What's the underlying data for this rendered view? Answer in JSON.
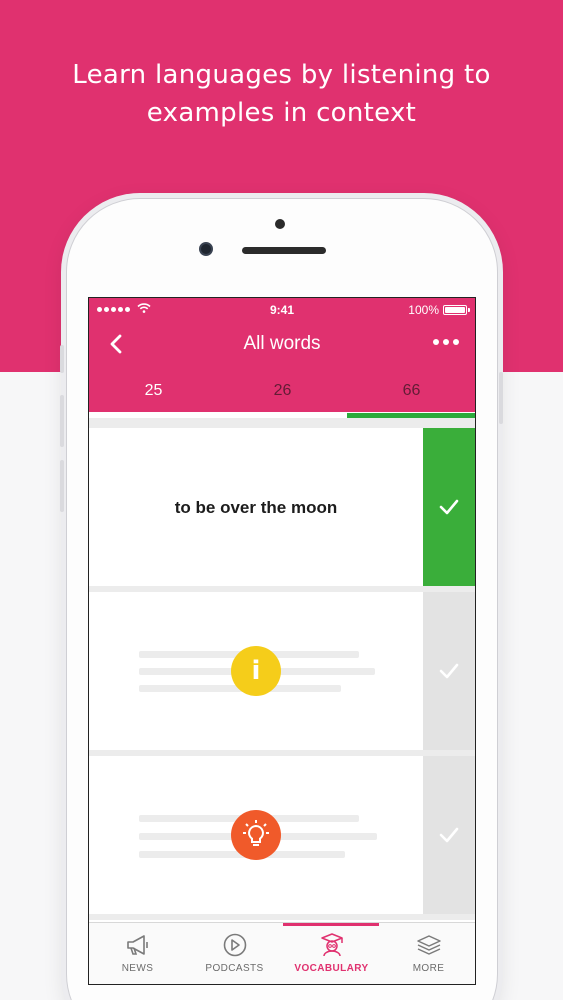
{
  "promo": {
    "headline_line1": "Learn languages by listening to",
    "headline_line2": "examples in context",
    "background_color": "#e0316f"
  },
  "status_bar": {
    "time": "9:41",
    "battery": "100%"
  },
  "nav": {
    "title": "All words",
    "back_icon": "chevron-left-icon",
    "more_icon": "more-dots-icon"
  },
  "count_tabs": [
    {
      "label": "25",
      "active": false
    },
    {
      "label": "26",
      "active": false
    },
    {
      "label": "66",
      "active": true
    }
  ],
  "cards": [
    {
      "text": "to be over the moon",
      "checked": true
    },
    {
      "icon": "info-icon",
      "checked": false
    },
    {
      "icon": "lightbulb-icon",
      "checked": false
    }
  ],
  "bottom_tabs": [
    {
      "label": "NEWS",
      "icon": "megaphone-icon",
      "active": false
    },
    {
      "label": "PODCASTS",
      "icon": "play-circle-icon",
      "active": false
    },
    {
      "label": "VOCABULARY",
      "icon": "student-icon",
      "active": true
    },
    {
      "label": "MORE",
      "icon": "layers-icon",
      "active": false
    }
  ],
  "colors": {
    "brand": "#e0316f",
    "success": "#3aae3a",
    "info_badge": "#f5cd1a",
    "tip_badge": "#f05a2a"
  }
}
